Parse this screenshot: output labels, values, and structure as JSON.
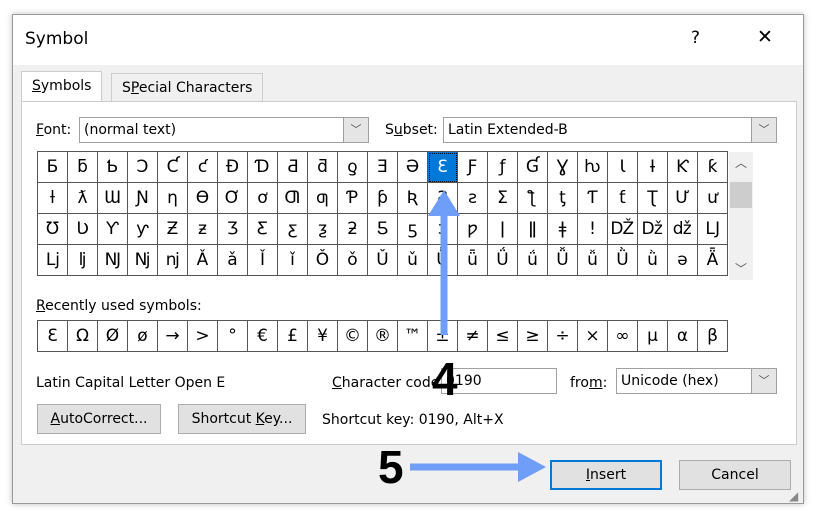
{
  "window": {
    "title": "Symbol",
    "help_label": "?",
    "close_label": "✕"
  },
  "tabs": [
    {
      "label": "Symbols",
      "hotkey": "S",
      "rest": "ymbols"
    },
    {
      "label": "Special Characters",
      "hotkey": "P",
      "pre": "S",
      "rest": "ecial Characters"
    }
  ],
  "font": {
    "label_hot": "F",
    "label_rest": "ont:",
    "value": "(normal text)"
  },
  "subset": {
    "label_hot": "u",
    "label_pre": "S",
    "label_rest": "bset:",
    "value": "Latin Extended-B"
  },
  "symbols": [
    [
      "Ƃ",
      "ƃ",
      "Ƅ",
      "Ɔ",
      "Ƈ",
      "ƈ",
      "Ɖ",
      "Ɗ",
      "Ƌ",
      "ƌ",
      "ƍ",
      "Ǝ",
      "Ə",
      "Ɛ",
      "Ƒ",
      "ƒ",
      "Ɠ",
      "Ɣ",
      "ƕ",
      "Ɩ",
      "Ɨ",
      "Ƙ",
      "ƙ"
    ],
    [
      "ƚ",
      "ƛ",
      "Ɯ",
      "Ɲ",
      "ƞ",
      "Ɵ",
      "Ơ",
      "ơ",
      "Ƣ",
      "ƣ",
      "Ƥ",
      "ƥ",
      "Ʀ",
      "Ƨ",
      "ƨ",
      "Ʃ",
      "ƪ",
      "ƫ",
      "Ƭ",
      "ƭ",
      "Ʈ",
      "Ư",
      "ư"
    ],
    [
      "Ʊ",
      "Ʋ",
      "Ƴ",
      "ƴ",
      "Ƶ",
      "ƶ",
      "Ʒ",
      "Ƹ",
      "ƹ",
      "ƺ",
      "ƻ",
      "Ƽ",
      "ƽ",
      "ƾ",
      "ƿ",
      "ǀ",
      "ǁ",
      "ǂ",
      "ǃ",
      "Ǆ",
      "ǅ",
      "ǆ",
      "Ǉ"
    ],
    [
      "ǈ",
      "ǉ",
      "Ǌ",
      "ǋ",
      "ǌ",
      "Ǎ",
      "ǎ",
      "Ǐ",
      "ǐ",
      "Ǒ",
      "ǒ",
      "Ǔ",
      "ǔ",
      "Ǖ",
      "ǖ",
      "Ǘ",
      "ǘ",
      "Ǚ",
      "ǚ",
      "Ǜ",
      "ǜ",
      "ǝ",
      "Ǟ"
    ]
  ],
  "selected_symbol": "Ɛ",
  "recent": {
    "label_hot": "R",
    "label_rest": "ecently used symbols:",
    "items": [
      "Ɛ",
      "Ω",
      "Ø",
      "ø",
      "→",
      ">",
      "°",
      "€",
      "£",
      "¥",
      "©",
      "®",
      "™",
      "±",
      "≠",
      "≤",
      "≥",
      "÷",
      "×",
      "∞",
      "µ",
      "α",
      "β"
    ]
  },
  "char_name": "Latin Capital Letter Open E",
  "char_code": {
    "label_hot": "C",
    "label_rest": "haracter code:",
    "value": "0190"
  },
  "from": {
    "label_pre": "fro",
    "label_hot": "m",
    "label_rest": ":",
    "value": "Unicode (hex)"
  },
  "autocorrect": {
    "hot": "A",
    "rest": "utoCorrect..."
  },
  "shortcut_key_btn": {
    "pre": "Shortcut ",
    "hot": "K",
    "rest": "ey..."
  },
  "shortcut_text": "Shortcut key: 0190, Alt+X",
  "insert": {
    "hot": "I",
    "rest": "nsert"
  },
  "cancel": "Cancel",
  "annotations": {
    "step4": "4",
    "step5": "5",
    "arrow_color": "#6f9ef8"
  },
  "colors": {
    "selection": "#0078d7"
  }
}
